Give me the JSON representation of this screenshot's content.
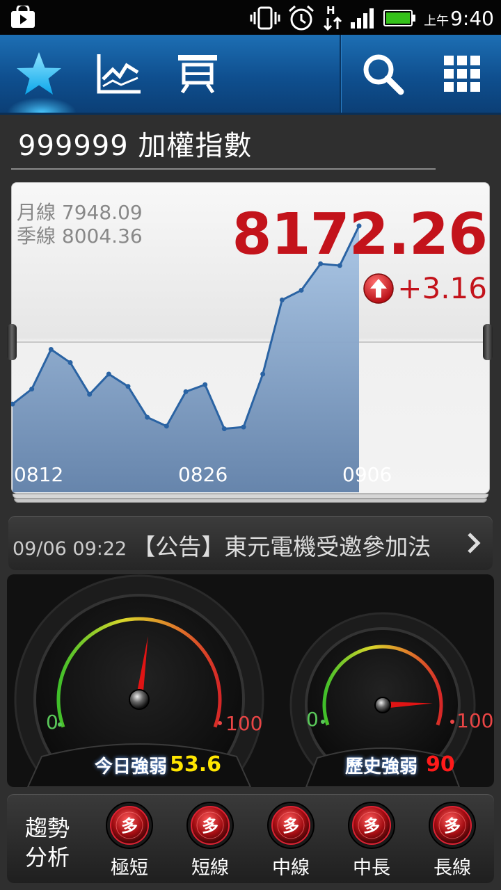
{
  "status_bar": {
    "ampm": "上午",
    "time": "9:40"
  },
  "header": {
    "title": "999999 加權指數"
  },
  "chart_data": {
    "type": "area",
    "x_tick_labels": [
      "0812",
      "0826",
      "0906"
    ],
    "values": [
      8020,
      8037,
      8082,
      8067,
      8031,
      8054,
      8040,
      8005,
      7995,
      8034,
      8042,
      7992,
      7994,
      8054,
      8138,
      8149,
      8179,
      8177,
      8222
    ],
    "moving_averages": {
      "month_label": "月線",
      "month_value": "7948.09",
      "quarter_label": "季線",
      "quarter_value": "8004.36"
    },
    "price": "8172.26",
    "change": "+3.16",
    "color_up": "#c3131b"
  },
  "news": {
    "time": "09/06 09:22",
    "text": "【公告】東元電機受邀參加法"
  },
  "gauges": [
    {
      "label": "今日強弱",
      "value": "53.6",
      "min": "0",
      "max": "100",
      "level": 0.536,
      "value_color": "#ffe600"
    },
    {
      "label": "歷史強弱",
      "value": "90",
      "min": "0",
      "max": "100",
      "level": 0.9,
      "value_color": "#ff1a1a"
    }
  ],
  "trend": {
    "title": "趨勢分析",
    "title_line1": "趨勢",
    "title_line2": "分析",
    "badge": "多",
    "items": [
      "極短",
      "短線",
      "中線",
      "中長",
      "長線"
    ]
  }
}
